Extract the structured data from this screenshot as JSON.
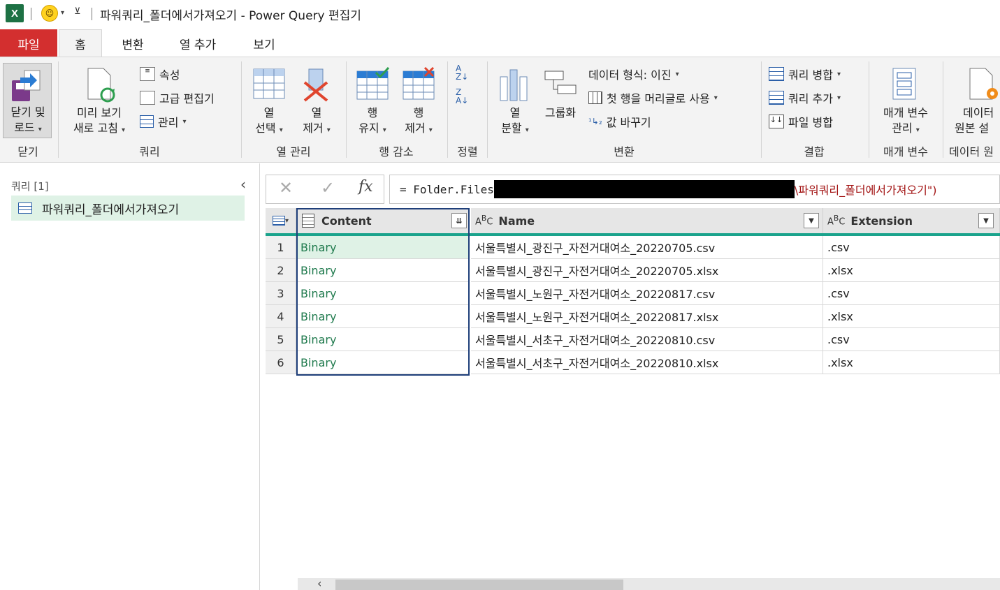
{
  "window": {
    "title": "파워쿼리_폴더에서가져오기 - Power Query 편집기",
    "app_icon_letter": "X"
  },
  "tabs": [
    "파일",
    "홈",
    "변환",
    "열 추가",
    "보기"
  ],
  "ribbon": {
    "close_group": {
      "label": "닫기",
      "close_load_line1": "닫기 및",
      "close_load_line2": "로드"
    },
    "query_group": {
      "label": "쿼리",
      "refresh_line1": "미리 보기",
      "refresh_line2": "새로 고침",
      "properties": "속성",
      "advanced_editor": "고급 편집기",
      "manage": "관리"
    },
    "column_mgmt_group": {
      "label": "열 관리",
      "choose_line1": "열",
      "choose_line2": "선택",
      "remove_line1": "열",
      "remove_line2": "제거"
    },
    "reduce_rows_group": {
      "label": "행 감소",
      "keep_line1": "행",
      "keep_line2": "유지",
      "remove_line1": "행",
      "remove_line2": "제거"
    },
    "sort_group": {
      "label": "정렬"
    },
    "transform_group": {
      "label": "변환",
      "split_line1": "열",
      "split_line2": "분할",
      "group_by": "그룹화",
      "data_type": "데이터 형식: 이진",
      "first_row_header": "첫 행을 머리글로 사용",
      "replace_values": "값 바꾸기"
    },
    "combine_group": {
      "label": "결합",
      "merge_queries": "쿼리 병합",
      "append_queries": "쿼리 추가",
      "combine_files": "파일 병합"
    },
    "params_group": {
      "label": "매개 변수",
      "manage_line1": "매개 변수",
      "manage_line2": "관리"
    },
    "datasource_group": {
      "label": "데이터 원",
      "settings_line1": "데이터",
      "settings_line2": "원본 설"
    }
  },
  "queries_panel": {
    "header": "쿼리 [1]",
    "items": [
      {
        "name": "파워쿼리_폴더에서가져오기"
      }
    ]
  },
  "formula": {
    "prefix": "= Folder.Files",
    "suffix": "\\파워쿼리_폴더에서가져오기\")"
  },
  "grid": {
    "columns": [
      {
        "name": "Content",
        "type_icon": "binary-icon"
      },
      {
        "name": "Name",
        "type_icon": "text-type-icon"
      },
      {
        "name": "Extension",
        "type_icon": "text-type-icon"
      }
    ],
    "rows": [
      {
        "num": "1",
        "content": "Binary",
        "name": "서울특별시_광진구_자전거대여소_20220705.csv",
        "ext": ".csv"
      },
      {
        "num": "2",
        "content": "Binary",
        "name": "서울특별시_광진구_자전거대여소_20220705.xlsx",
        "ext": ".xlsx"
      },
      {
        "num": "3",
        "content": "Binary",
        "name": "서울특별시_노원구_자전거대여소_20220817.csv",
        "ext": ".csv"
      },
      {
        "num": "4",
        "content": "Binary",
        "name": "서울특별시_노원구_자전거대여소_20220817.xlsx",
        "ext": ".xlsx"
      },
      {
        "num": "5",
        "content": "Binary",
        "name": "서울특별시_서초구_자전거대여소_20220810.csv",
        "ext": ".csv"
      },
      {
        "num": "6",
        "content": "Binary",
        "name": "서울특별시_서초구_자전거대여소_20220810.xlsx",
        "ext": ".xlsx"
      }
    ]
  },
  "colors": {
    "file_tab": "#d32f2f",
    "header_accent": "#1aa38c",
    "selected_query": "#dff2e6",
    "binary_text": "#1f7a4d"
  }
}
